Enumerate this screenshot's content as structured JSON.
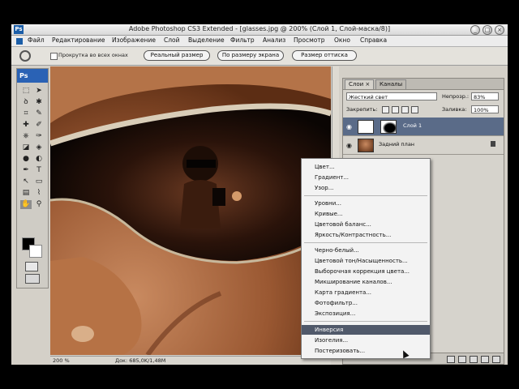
{
  "window": {
    "title": "Adobe Photoshop CS3 Extended - [glasses.jpg @ 200% (Слой 1, Слой-маска/8)]",
    "controls": [
      "_",
      "□",
      "×"
    ]
  },
  "menubar": {
    "items": [
      "Файл",
      "Редактирование",
      "Изображение",
      "Слой",
      "Выделение",
      "Фильтр",
      "Анализ",
      "Просмотр",
      "Окно",
      "Справка"
    ]
  },
  "options": {
    "scroll_all_label": "Прокрутка во всех окнах",
    "actual_pixels": "Реальный размер",
    "fit_screen": "По размеру экрана",
    "print_size": "Размер оттиска"
  },
  "toolbox": {
    "logo": "Ps"
  },
  "status": {
    "zoom": "200 %",
    "doc": "Док: 685,0K/1,48M"
  },
  "layers_panel": {
    "tabs": [
      "Слои ×",
      "Каналы"
    ],
    "blend_mode": "Жесткий свет",
    "opacity_label": "Непрозр.:",
    "opacity_value": "83%",
    "lock_label": "Закрепить:",
    "fill_label": "Заливка:",
    "fill_value": "100%",
    "layers": [
      {
        "name": "Слой 1",
        "selected": true
      },
      {
        "name": "Задний план",
        "selected": false,
        "locked": true
      }
    ]
  },
  "context_menu": {
    "groups": [
      [
        "Цвет...",
        "Градиент...",
        "Узор..."
      ],
      [
        "Уровни...",
        "Кривые...",
        "Цветовой баланс...",
        "Яркость/Контрастность..."
      ],
      [
        "Черно-белый...",
        "Цветовой тон/Насыщенность...",
        "Выборочная коррекция цвета...",
        "Микширование каналов...",
        "Карта градиента...",
        "Фотофильтр...",
        "Экспозиция..."
      ],
      [
        "Инверсия",
        "Изогелия...",
        "Постеризовать..."
      ]
    ],
    "highlighted": "Инверсия"
  },
  "colors": {
    "accent": "#2a62b5",
    "menu_highlight": "#50596a",
    "layer_selected": "#5a6b88"
  }
}
